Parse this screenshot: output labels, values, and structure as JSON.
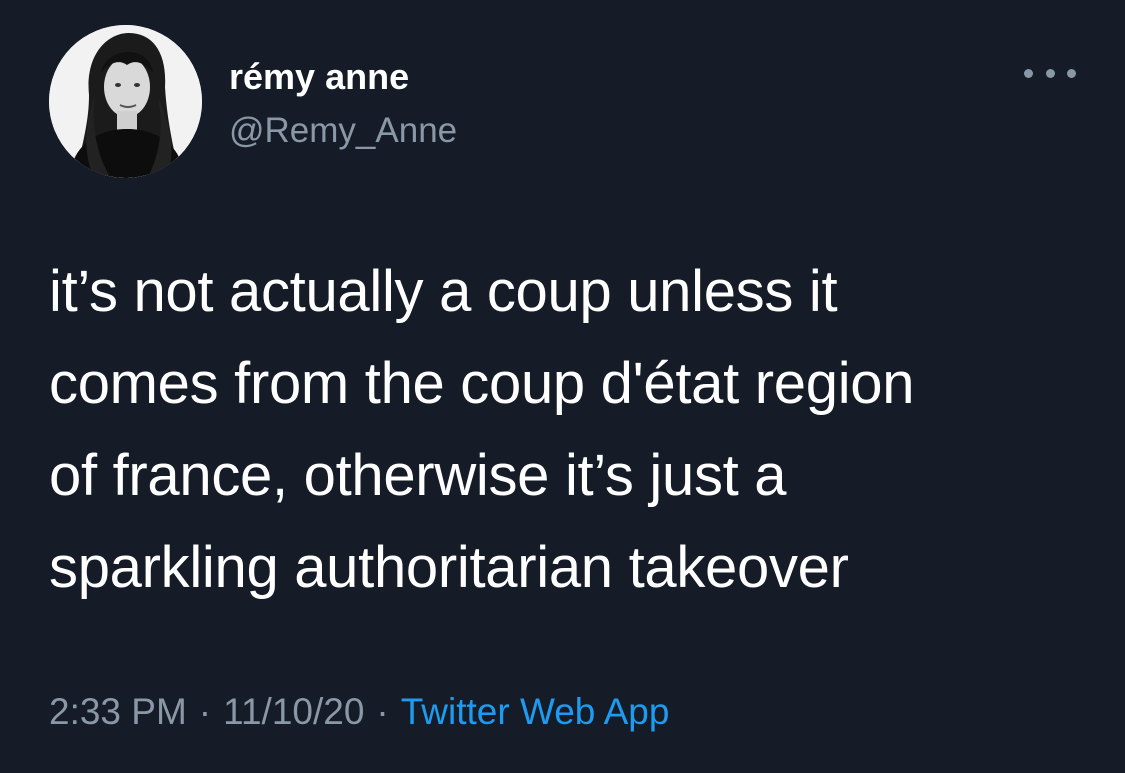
{
  "author": {
    "display_name": "rémy anne",
    "handle": "@Remy_Anne",
    "avatar_icon": "user-avatar-photo"
  },
  "tweet": {
    "text": "it’s not actually a coup unless it\ncomes from the coup d'état region\nof france, otherwise it’s just a\nsparkling authoritarian takeover",
    "time": "2:33 PM",
    "separator": "·",
    "date": "11/10/20",
    "source": "Twitter Web App"
  },
  "menu": {
    "icon": "more-options-icon"
  },
  "colors": {
    "background": "#151c27",
    "text": "#ffffff",
    "secondary_text": "#8a97a6",
    "link": "#1d9bf0"
  }
}
